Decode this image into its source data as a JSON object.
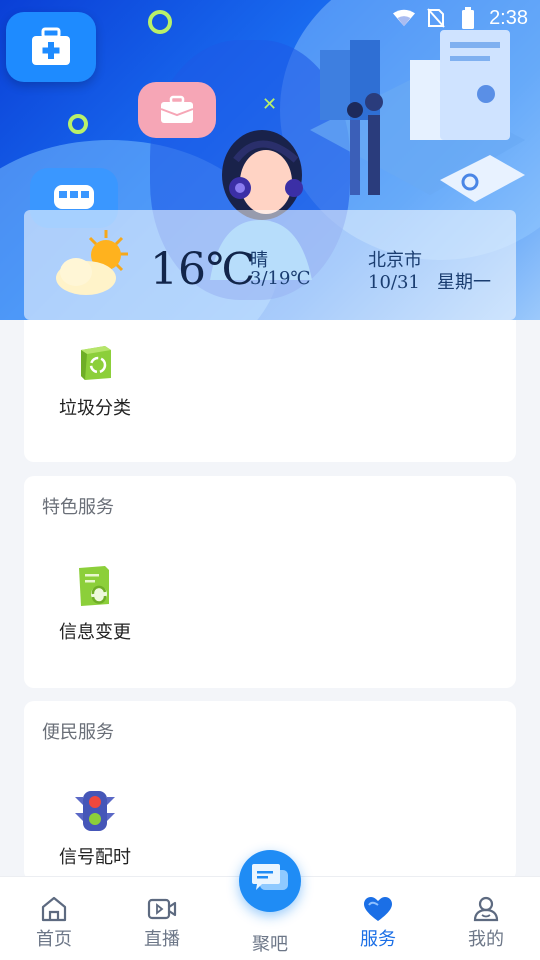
{
  "status_bar": {
    "time": "2:38"
  },
  "weather": {
    "temperature": "16℃",
    "condition": "晴",
    "range": "3/19℃",
    "city": "北京市",
    "date": "10/31",
    "weekday": "星期一"
  },
  "sections": [
    {
      "title": "",
      "items": [
        {
          "label": "垃圾分类",
          "icon": "recycle-box-icon"
        }
      ]
    },
    {
      "title": "特色服务",
      "items": [
        {
          "label": "信息变更",
          "icon": "document-refresh-icon"
        }
      ]
    },
    {
      "title": "便民服务",
      "items": [
        {
          "label": "信号配时",
          "icon": "traffic-light-icon"
        }
      ]
    }
  ],
  "tabbar": {
    "items": [
      {
        "label": "首页",
        "icon": "home-icon"
      },
      {
        "label": "直播",
        "icon": "video-camera-icon"
      },
      {
        "label": "聚吧",
        "icon": "chat-bubbles-icon"
      },
      {
        "label": "服务",
        "icon": "heart-icon",
        "active": true
      },
      {
        "label": "我的",
        "icon": "user-icon"
      }
    ]
  },
  "colors": {
    "accent": "#1b6fe6",
    "banner_dark": "#0a3fd6",
    "banner_light": "#9cc9fb"
  }
}
